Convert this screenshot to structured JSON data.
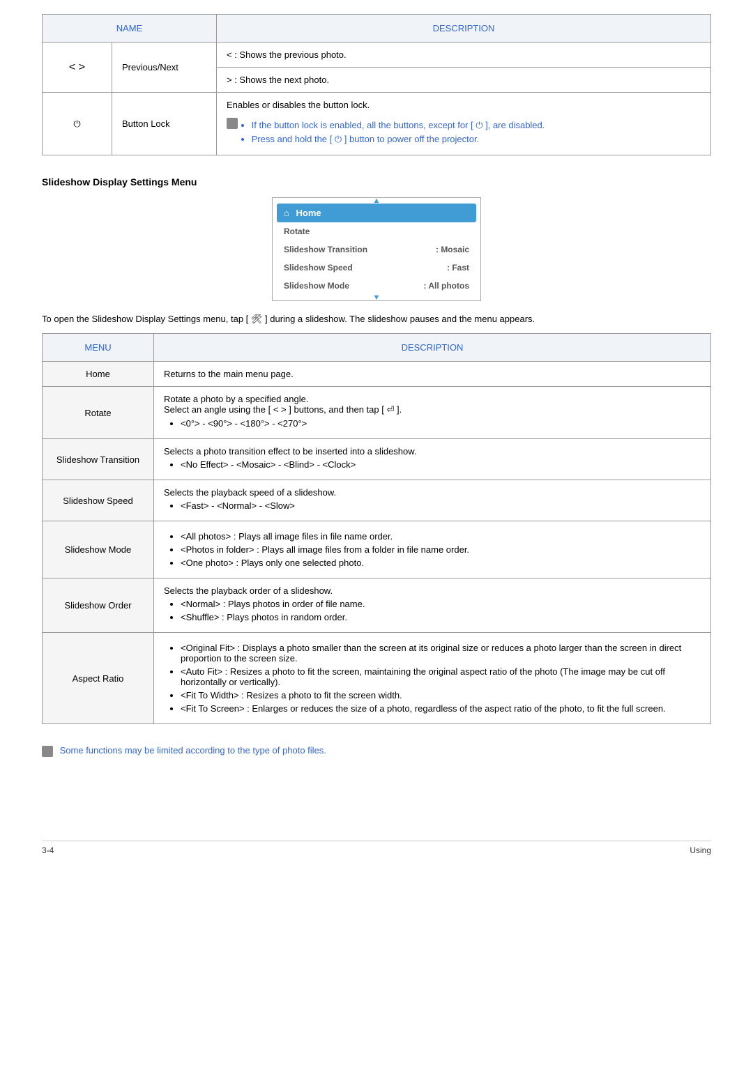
{
  "table1": {
    "headers": {
      "name": "NAME",
      "desc": "DESCRIPTION"
    },
    "rows": [
      {
        "icon": "< >",
        "name": "Previous/Next",
        "lines": [
          "< : Shows the previous photo.",
          "> : Shows the next photo."
        ]
      },
      {
        "icon": "⏻",
        "name": "Button Lock",
        "intro": "Enables or disables the button lock.",
        "bullets": [
          "If the button lock is enabled, all the buttons, except for [ ⏻ ], are disabled.",
          "Press and hold the [ ⏻ ] button to power off the projector."
        ]
      }
    ]
  },
  "section_heading": "Slideshow Display Settings Menu",
  "menu_box": {
    "home": "Home",
    "rows": [
      {
        "label": "Rotate",
        "value": ""
      },
      {
        "label": "Slideshow Transition",
        "value": ": Mosaic"
      },
      {
        "label": "Slideshow Speed",
        "value": ": Fast"
      },
      {
        "label": "Slideshow Mode",
        "value": ": All photos"
      }
    ]
  },
  "paragraph1": "To open the Slideshow Display Settings menu, tap [ 🛠 ] during a slideshow. The slideshow pauses and the menu appears.",
  "table2": {
    "headers": {
      "menu": "MENU",
      "desc": "DESCRIPTION"
    },
    "rows": {
      "home": {
        "label": "Home",
        "desc": "Returns to the main menu page."
      },
      "rotate": {
        "label": "Rotate",
        "line1": "Rotate a photo by a specified angle.",
        "line2": "Select an angle using the [ < > ] buttons, and then tap [ ⏎ ].",
        "bullet": "<0°> - <90°> - <180°> - <270°>"
      },
      "transition": {
        "label": "Slideshow Transition",
        "line1": "Selects a photo transition effect to be inserted into a slideshow.",
        "bullet": "<No Effect> - <Mosaic> - <Blind> - <Clock>"
      },
      "speed": {
        "label": "Slideshow Speed",
        "line1": "Selects the playback speed of a slideshow.",
        "bullet": "<Fast> - <Normal> - <Slow>"
      },
      "mode": {
        "label": "Slideshow Mode",
        "bullets": [
          "<All photos> : Plays all image files in file name order.",
          "<Photos in folder> : Plays all image files from a folder in file name order.",
          "<One photo> : Plays only one selected photo."
        ]
      },
      "order": {
        "label": "Slideshow Order",
        "line1": "Selects the playback order of a slideshow.",
        "bullets": [
          "<Normal> : Plays photos in order of file name.",
          "<Shuffle> : Plays photos in random order."
        ]
      },
      "aspect": {
        "label": "Aspect Ratio",
        "bullets": [
          "<Original Fit> : Displays a photo smaller than the screen at its original size or reduces a photo larger than the screen in direct proportion to the screen size.",
          "<Auto Fit> : Resizes a photo to fit the screen, maintaining the original aspect ratio of the photo (The image may be cut off horizontally or vertically).",
          "<Fit To Width> : Resizes a photo to fit the screen width.",
          "<Fit To Screen> : Enlarges or reduces the size of a photo, regardless of the aspect ratio of the photo, to fit the full screen."
        ]
      }
    }
  },
  "note": "Some functions may be limited according to the type of photo files.",
  "footer": {
    "left": "3-4",
    "right": "Using"
  }
}
